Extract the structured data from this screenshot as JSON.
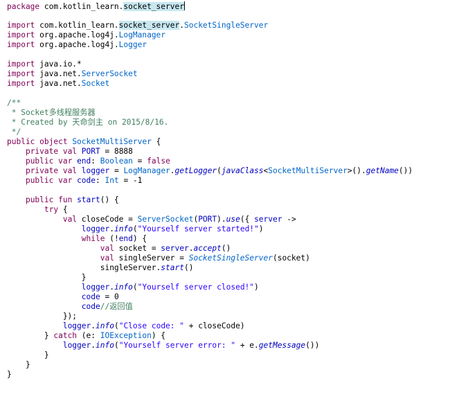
{
  "editor": {
    "lines": [
      {
        "t": [
          {
            "x": "package",
            "c": "kw"
          },
          {
            "x": " com.kotlin_learn."
          },
          {
            "x": "socket_server",
            "c": "hl"
          },
          {
            "caret": true
          }
        ]
      },
      {
        "t": []
      },
      {
        "t": [
          {
            "x": "import",
            "c": "kw"
          },
          {
            "x": " com.kotlin_learn."
          },
          {
            "x": "socket_server",
            "c": "hl"
          },
          {
            "x": "."
          },
          {
            "x": "SocketSingleServer",
            "c": "typ"
          }
        ]
      },
      {
        "t": [
          {
            "x": "import",
            "c": "kw"
          },
          {
            "x": " org.apache.log4j."
          },
          {
            "x": "LogManager",
            "c": "typ"
          }
        ]
      },
      {
        "t": [
          {
            "x": "import",
            "c": "kw"
          },
          {
            "x": " org.apache.log4j."
          },
          {
            "x": "Logger",
            "c": "typ"
          }
        ]
      },
      {
        "t": []
      },
      {
        "t": [
          {
            "x": "import",
            "c": "kw"
          },
          {
            "x": " java.io.*"
          }
        ]
      },
      {
        "t": [
          {
            "x": "import",
            "c": "kw"
          },
          {
            "x": " java.net."
          },
          {
            "x": "ServerSocket",
            "c": "typ"
          }
        ]
      },
      {
        "t": [
          {
            "x": "import",
            "c": "kw"
          },
          {
            "x": " java.net."
          },
          {
            "x": "Socket",
            "c": "typ"
          }
        ]
      },
      {
        "t": []
      },
      {
        "t": [
          {
            "x": "/**",
            "c": "cm"
          }
        ]
      },
      {
        "t": [
          {
            "x": " * Socket多线程服务器",
            "c": "cm"
          }
        ]
      },
      {
        "t": [
          {
            "x": " * Created by 天命剑主 on 2015/8/16.",
            "c": "cm"
          }
        ]
      },
      {
        "t": [
          {
            "x": " */",
            "c": "cm"
          }
        ]
      },
      {
        "t": [
          {
            "x": "public object",
            "c": "kw"
          },
          {
            "x": " "
          },
          {
            "x": "SocketMultiServer",
            "c": "typ"
          },
          {
            "x": " {"
          }
        ]
      },
      {
        "t": [
          {
            "x": "    "
          },
          {
            "x": "private val",
            "c": "kw"
          },
          {
            "x": " "
          },
          {
            "x": "PORT",
            "c": "fld"
          },
          {
            "x": " = 8888"
          }
        ]
      },
      {
        "t": [
          {
            "x": "    "
          },
          {
            "x": "public var",
            "c": "kw"
          },
          {
            "x": " "
          },
          {
            "x": "end",
            "c": "fld"
          },
          {
            "x": ": "
          },
          {
            "x": "Boolean",
            "c": "typ"
          },
          {
            "x": " = "
          },
          {
            "x": "false",
            "c": "kw"
          }
        ]
      },
      {
        "t": [
          {
            "x": "    "
          },
          {
            "x": "private val",
            "c": "kw"
          },
          {
            "x": " "
          },
          {
            "x": "logger",
            "c": "fld"
          },
          {
            "x": " = "
          },
          {
            "x": "LogManager",
            "c": "typ"
          },
          {
            "x": "."
          },
          {
            "x": "getLogger",
            "c": "fn ital"
          },
          {
            "x": "("
          },
          {
            "x": "javaClass",
            "c": "fn ital"
          },
          {
            "x": "<"
          },
          {
            "x": "SocketMultiServer",
            "c": "typ"
          },
          {
            "x": ">()."
          },
          {
            "x": "getName",
            "c": "fn ital"
          },
          {
            "x": "())"
          }
        ]
      },
      {
        "t": [
          {
            "x": "    "
          },
          {
            "x": "public var",
            "c": "kw"
          },
          {
            "x": " "
          },
          {
            "x": "code",
            "c": "fld"
          },
          {
            "x": ": "
          },
          {
            "x": "Int",
            "c": "typ"
          },
          {
            "x": " = -1"
          }
        ]
      },
      {
        "t": []
      },
      {
        "t": [
          {
            "x": "    "
          },
          {
            "x": "public fun",
            "c": "kw"
          },
          {
            "x": " "
          },
          {
            "x": "start",
            "c": "fn"
          },
          {
            "x": "() {"
          }
        ]
      },
      {
        "t": [
          {
            "x": "        "
          },
          {
            "x": "try",
            "c": "kw"
          },
          {
            "x": " {"
          }
        ]
      },
      {
        "t": [
          {
            "x": "            "
          },
          {
            "x": "val",
            "c": "kw"
          },
          {
            "x": " closeCode = "
          },
          {
            "x": "ServerSocket",
            "c": "typ"
          },
          {
            "x": "("
          },
          {
            "x": "PORT",
            "c": "fld"
          },
          {
            "x": ")."
          },
          {
            "x": "use",
            "c": "fn ital"
          },
          {
            "x": "({ "
          },
          {
            "x": "server",
            "c": "fld"
          },
          {
            "x": " ->"
          }
        ]
      },
      {
        "t": [
          {
            "x": "                "
          },
          {
            "x": "logger",
            "c": "fld"
          },
          {
            "x": "."
          },
          {
            "x": "info",
            "c": "fn ital"
          },
          {
            "x": "("
          },
          {
            "x": "\"Yourself server started!\"",
            "c": "str"
          },
          {
            "x": ")"
          }
        ]
      },
      {
        "t": [
          {
            "x": "                "
          },
          {
            "x": "while",
            "c": "kw"
          },
          {
            "x": " (!"
          },
          {
            "x": "end",
            "c": "fld"
          },
          {
            "x": ") {"
          }
        ]
      },
      {
        "t": [
          {
            "x": "                    "
          },
          {
            "x": "val",
            "c": "kw"
          },
          {
            "x": " socket = "
          },
          {
            "x": "server",
            "c": "fld"
          },
          {
            "x": "."
          },
          {
            "x": "accept",
            "c": "fn ital"
          },
          {
            "x": "()"
          }
        ]
      },
      {
        "t": [
          {
            "x": "                    "
          },
          {
            "x": "val",
            "c": "kw"
          },
          {
            "x": " singleServer = "
          },
          {
            "x": "SocketSingleServer",
            "c": "typ ital"
          },
          {
            "x": "(socket)"
          }
        ]
      },
      {
        "t": [
          {
            "x": "                    "
          },
          {
            "x": "singleServer."
          },
          {
            "x": "start",
            "c": "fn ital"
          },
          {
            "x": "()"
          }
        ]
      },
      {
        "t": [
          {
            "x": "                }"
          }
        ]
      },
      {
        "t": [
          {
            "x": "                "
          },
          {
            "x": "logger",
            "c": "fld"
          },
          {
            "x": "."
          },
          {
            "x": "info",
            "c": "fn ital"
          },
          {
            "x": "("
          },
          {
            "x": "\"Yourself server closed!\"",
            "c": "str"
          },
          {
            "x": ")"
          }
        ]
      },
      {
        "t": [
          {
            "x": "                "
          },
          {
            "x": "code",
            "c": "fld"
          },
          {
            "x": " = 0"
          }
        ]
      },
      {
        "t": [
          {
            "x": "                "
          },
          {
            "x": "code",
            "c": "fld"
          },
          {
            "x": "//返回值",
            "c": "cm"
          }
        ]
      },
      {
        "t": [
          {
            "x": "            });"
          }
        ]
      },
      {
        "t": [
          {
            "x": "            "
          },
          {
            "x": "logger",
            "c": "fld"
          },
          {
            "x": "."
          },
          {
            "x": "info",
            "c": "fn ital"
          },
          {
            "x": "("
          },
          {
            "x": "\"Close code: \"",
            "c": "str"
          },
          {
            "x": " + closeCode)"
          }
        ]
      },
      {
        "t": [
          {
            "x": "        } "
          },
          {
            "x": "catch",
            "c": "kw"
          },
          {
            "x": " (e: "
          },
          {
            "x": "IOException",
            "c": "typ"
          },
          {
            "x": ") {"
          }
        ]
      },
      {
        "t": [
          {
            "x": "            "
          },
          {
            "x": "logger",
            "c": "fld"
          },
          {
            "x": "."
          },
          {
            "x": "info",
            "c": "fn ital"
          },
          {
            "x": "("
          },
          {
            "x": "\"Yourself server error: \"",
            "c": "str"
          },
          {
            "x": " + e."
          },
          {
            "x": "getMessage",
            "c": "fn ital"
          },
          {
            "x": "())"
          }
        ]
      },
      {
        "t": [
          {
            "x": "        }"
          }
        ]
      },
      {
        "t": [
          {
            "x": "    }"
          }
        ]
      },
      {
        "t": [
          {
            "x": "}"
          }
        ]
      }
    ]
  }
}
